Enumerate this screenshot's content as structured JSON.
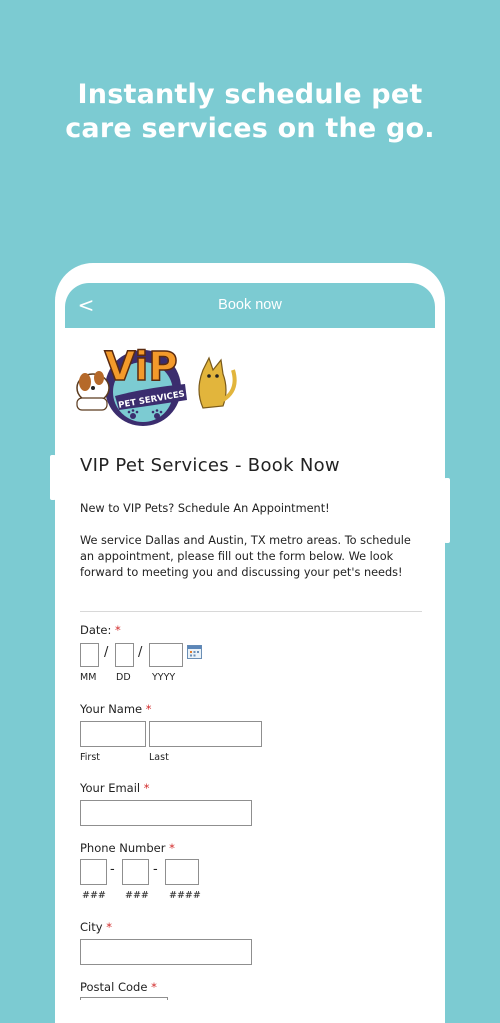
{
  "headline": {
    "line1": "Instantly schedule pet",
    "line2": "care services on the go."
  },
  "appbar": {
    "title": "Book now",
    "back_glyph": "<"
  },
  "logo": {
    "text_main": "ViP",
    "text_sub": "PET SERVICES"
  },
  "form": {
    "title": "VIP Pet Services - Book Now",
    "intro_p1": "New to VIP Pets? Schedule An Appointment!",
    "intro_p2": "We service Dallas and Austin, TX metro areas. To schedule an appointment, please fill out the form below. We look forward to meeting you and discussing your pet's needs!",
    "required_mark": "*",
    "date": {
      "label": "Date:",
      "sep": "/",
      "mm": "MM",
      "dd": "DD",
      "yyyy": "YYYY"
    },
    "name": {
      "label": "Your Name",
      "first": "First",
      "last": "Last"
    },
    "email": {
      "label": "Your Email"
    },
    "phone": {
      "label": "Phone Number",
      "sep": "-",
      "part1": "###",
      "part2": "###",
      "part3": "####"
    },
    "city": {
      "label": "City"
    },
    "postal": {
      "label": "Postal Code"
    }
  },
  "colors": {
    "background": "#7ccbd2",
    "accent": "#7ccbd2",
    "required": "#d22a2a"
  }
}
